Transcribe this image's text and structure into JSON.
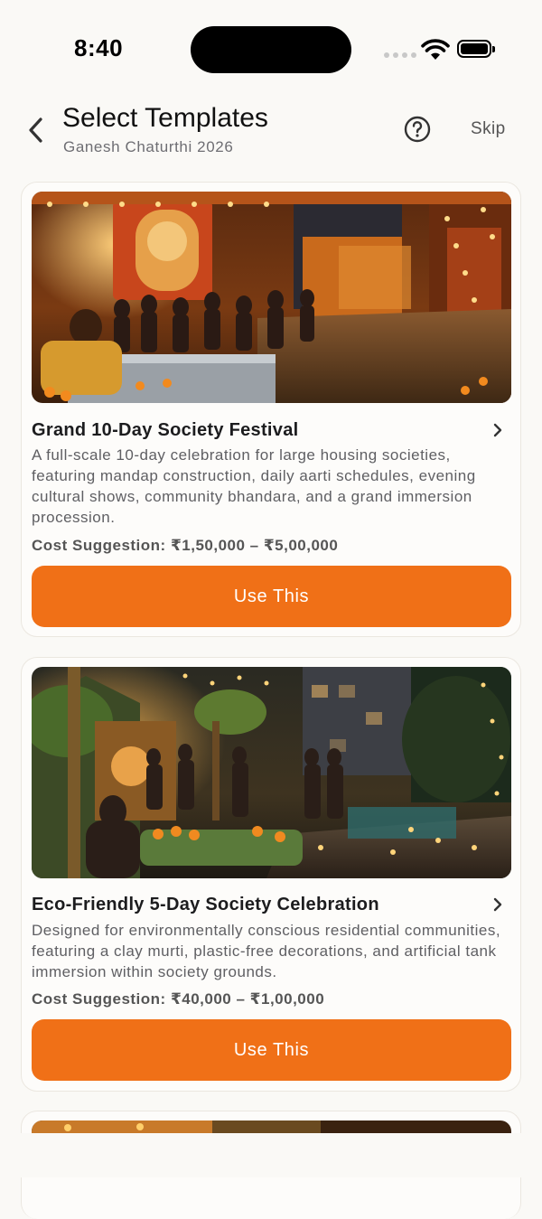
{
  "status_bar": {
    "time": "8:40"
  },
  "header": {
    "title": "Select Templates",
    "subtitle": "Ganesh Chaturthi 2026",
    "skip_label": "Skip"
  },
  "templates": [
    {
      "title": "Grand 10-Day Society Festival",
      "description": "A full-scale 10-day celebration for large housing societies, featuring mandap construction, daily aarti schedules, evening cultural shows, community bhandara, and a grand immersion procession.",
      "cost": "Cost Suggestion: ₹1,50,000 – ₹5,00,000",
      "button_label": "Use This"
    },
    {
      "title": "Eco-Friendly 5-Day Society Celebration",
      "description": "Designed for environmentally conscious residential communities, featuring a clay murti, plastic-free decorations, and artificial tank immersion within society grounds.",
      "cost": "Cost Suggestion: ₹40,000 – ₹1,00,000",
      "button_label": "Use This"
    }
  ],
  "colors": {
    "accent": "#f07017",
    "background": "#faf9f6"
  },
  "icons": [
    "back-chevron-icon",
    "help-icon",
    "chevron-right-icon",
    "wifi-icon",
    "battery-icon"
  ]
}
